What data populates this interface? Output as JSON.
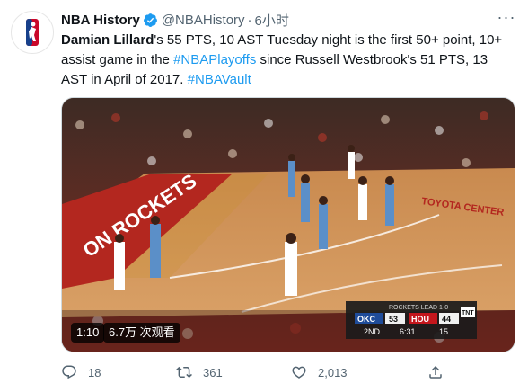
{
  "tweet": {
    "author_name": "NBA History",
    "handle": "@NBAHistory",
    "separator": "·",
    "time": "6小时",
    "more_label": "···",
    "text_bold": "Damian Lillard",
    "text_part1": "'s 55 PTS, 10 AST Tuesday night is the first 50+ point, 10+ assist game in the ",
    "hashtag_playoffs": "#NBAPlayoffs",
    "text_part2": " since Russell Westbrook's 51 PTS, 13 AST in April of 2017. ",
    "hashtag_vault": "#NBAVault"
  },
  "video": {
    "duration": "1:10",
    "views": "6.7万 次观看",
    "court_text_left": "ON ROCKETS",
    "court_text_right": "TOYOTA CENTER",
    "scoreboard": {
      "title": "ROCKETS LEAD 1-0",
      "team_away": "OKC",
      "score_away": "53",
      "team_home": "HOU",
      "score_home": "44",
      "quarter": "2ND",
      "clock": "6:31",
      "shot_clock": "15",
      "network": "TNT"
    }
  },
  "actions": {
    "replies": "18",
    "retweets": "361",
    "likes": "2,013"
  },
  "colors": {
    "link": "#1d9bf0",
    "verified": "#1d9bf0",
    "muted": "#536471"
  },
  "icons": [
    "nba-logo-icon",
    "verified-icon",
    "reply-icon",
    "retweet-icon",
    "like-icon",
    "share-icon"
  ]
}
